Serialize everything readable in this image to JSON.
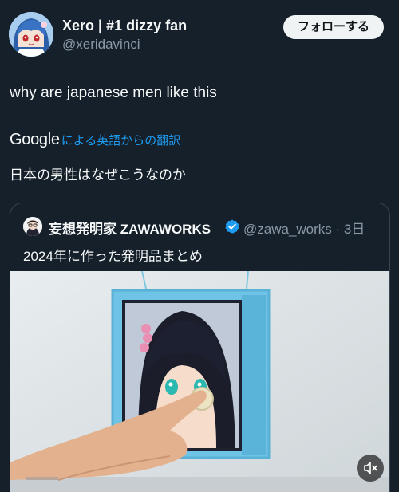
{
  "author": {
    "name": "Xero | #1 dizzy fan",
    "handle": "@xeridavinci",
    "avatar_icon": "anime-avatar-blue-hair"
  },
  "follow_label": "フォローする",
  "tweet": {
    "text": "why are japanese men like this",
    "google_label": "Google",
    "translate_label": "による英語からの翻訳",
    "translated_text": "日本の男性はなぜこうなのか"
  },
  "quote": {
    "name": "妄想発明家 ZAWAWORKS",
    "verified_icon": "verified-badge-icon",
    "handle_time": "@zawa_works · 3日",
    "text": "2024年に作った発明品まとめ",
    "media_icon": "video-anime-girl-frame",
    "mute_icon": "speaker-muted-icon"
  },
  "colors": {
    "background": "#15202b",
    "link": "#1d9bf0",
    "secondary_text": "#8b98a5",
    "verified": "#1d9bf0"
  }
}
